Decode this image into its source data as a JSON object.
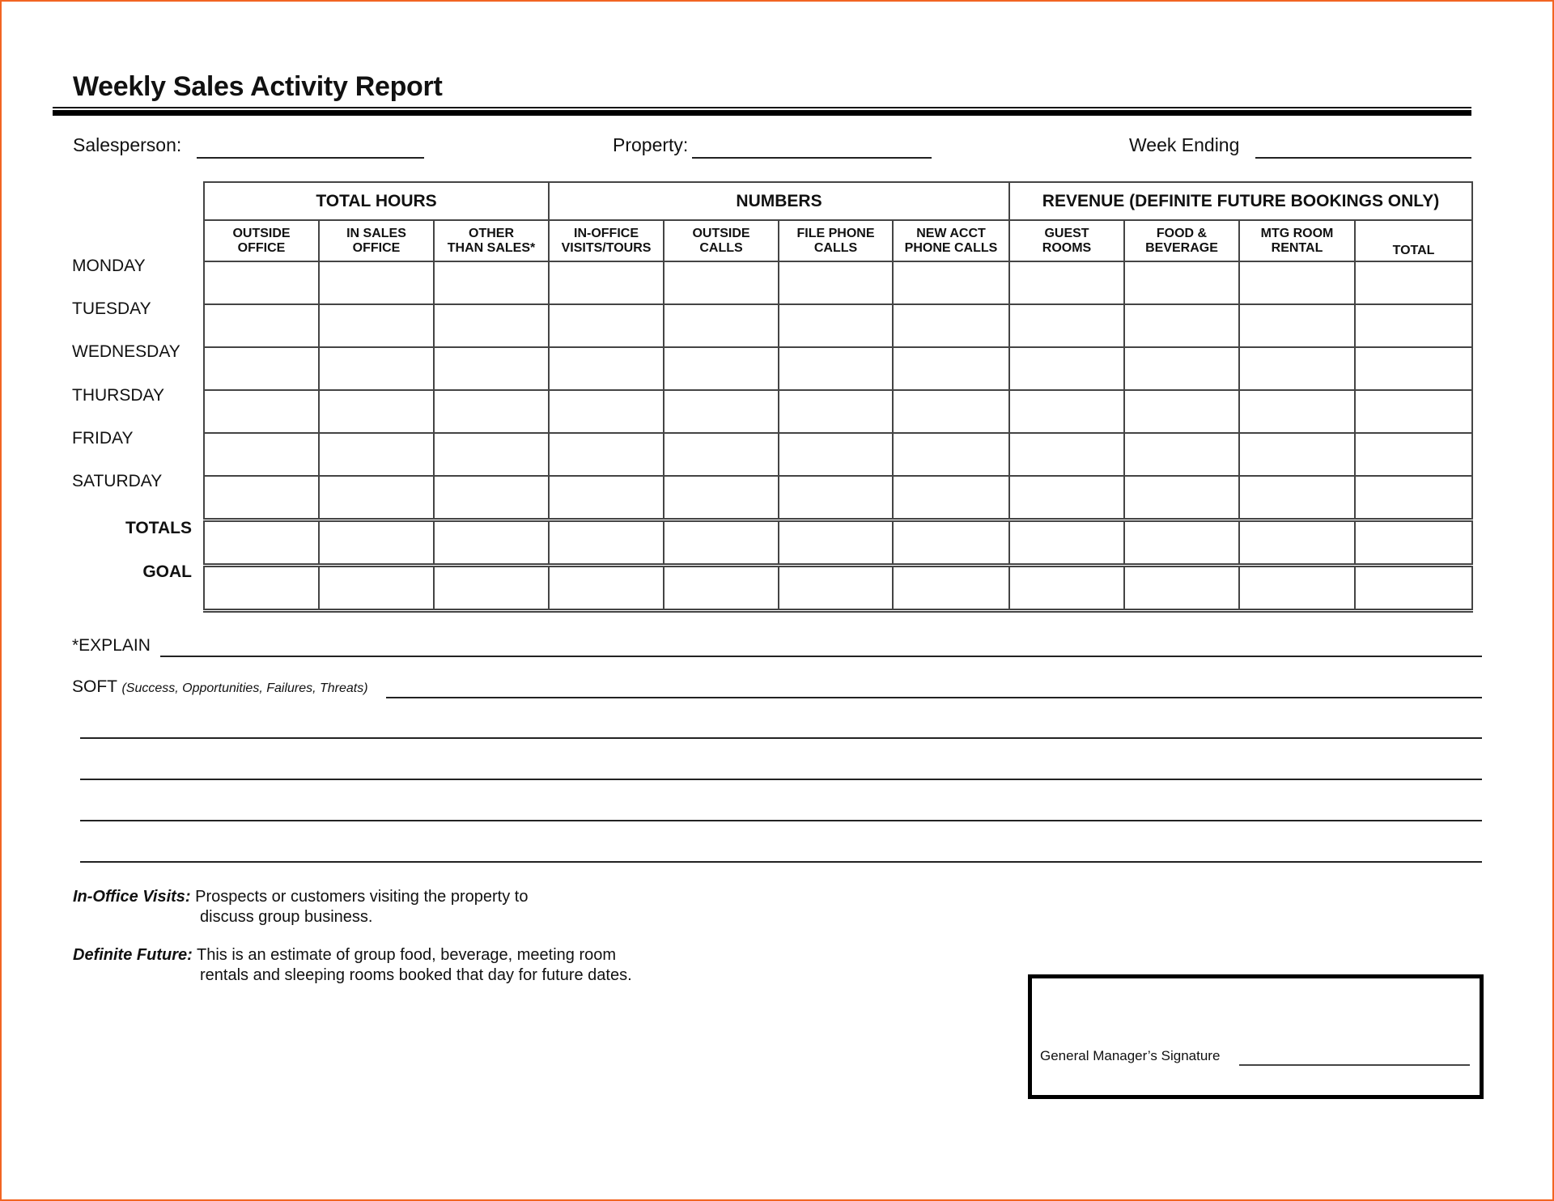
{
  "title": "Weekly Sales Activity Report",
  "fields": {
    "salesperson_label": "Salesperson:",
    "salesperson_value": "",
    "property_label": "Property:",
    "property_value": "",
    "week_ending_label": "Week Ending",
    "week_ending_value": ""
  },
  "table": {
    "groups": [
      {
        "label": "TOTAL HOURS",
        "span": 3
      },
      {
        "label": "NUMBERS",
        "span": 4
      },
      {
        "label": "REVENUE (DEFINITE FUTURE BOOKINGS ONLY)",
        "span": 4
      }
    ],
    "columns": [
      [
        "OUTSIDE",
        "OFFICE"
      ],
      [
        "IN SALES",
        "OFFICE"
      ],
      [
        "OTHER",
        "THAN SALES*"
      ],
      [
        "IN-OFFICE",
        "VISITS/TOURS"
      ],
      [
        "OUTSIDE",
        "CALLS"
      ],
      [
        "FILE PHONE",
        "CALLS"
      ],
      [
        "NEW ACCT",
        "PHONE CALLS"
      ],
      [
        "GUEST",
        "ROOMS"
      ],
      [
        "FOOD &",
        "BEVERAGE"
      ],
      [
        "MTG ROOM",
        "RENTAL"
      ],
      [
        "",
        "TOTAL"
      ]
    ],
    "days": [
      "MONDAY",
      "TUESDAY",
      "WEDNESDAY",
      "THURSDAY",
      "FRIDAY",
      "SATURDAY"
    ],
    "summary_rows": [
      "TOTALS",
      "GOAL"
    ]
  },
  "explain_label": "*EXPLAIN",
  "explain_value": "",
  "soft_label": "SOFT",
  "soft_note": "(Success, Opportunities, Failures, Threats)",
  "soft_value": "",
  "notes": [
    {
      "term": "In-Office Visits:",
      "line1": "Prospects or customers visiting the property to",
      "line2": "discuss group business."
    },
    {
      "term": "Definite Future:",
      "line1": "This is an estimate of group food, beverage, meeting room",
      "line2": "rentals and sleeping rooms booked that day for future dates."
    }
  ],
  "signature_label": "General Manager’s Signature"
}
